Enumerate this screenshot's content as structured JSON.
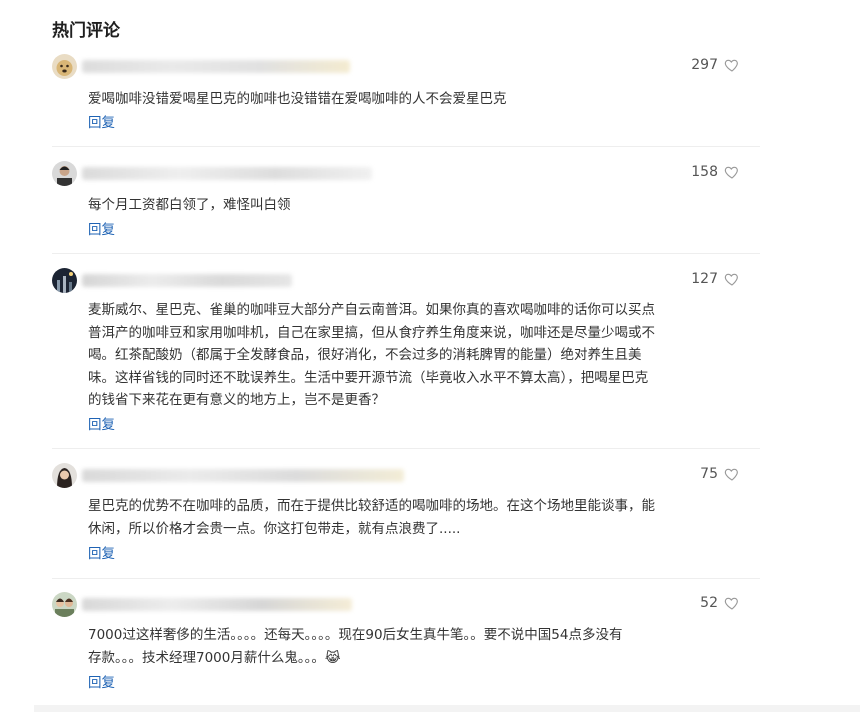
{
  "section_title": "热门评论",
  "reply_label": "回复",
  "comments": [
    {
      "likes": "297",
      "text": "爱喝咖啡没错爱喝星巴克的咖啡也没错错在爱喝咖啡的人不会爱星巴克"
    },
    {
      "likes": "158",
      "text": "每个月工资都白领了，难怪叫白领"
    },
    {
      "likes": "127",
      "text": "麦斯威尔、星巴克、雀巢的咖啡豆大部分产自云南普洱。如果你真的喜欢喝咖啡的话你可以买点\n普洱产的咖啡豆和家用咖啡机，自己在家里搞，但从食疗养生角度来说，咖啡还是尽量少喝或不\n喝。红茶配酸奶（都属于全发酵食品，很好消化，不会过多的消耗脾胃的能量）绝对养生且美\n味。这样省钱的同时还不耽误养生。生活中要开源节流（毕竟收入水平不算太高），把喝星巴克\n的钱省下来花在更有意义的地方上，岂不是更香？"
    },
    {
      "likes": "75",
      "text": "星巴克的优势不在咖啡的品质，而在于提供比较舒适的喝咖啡的场地。在这个场地里能谈事，能\n休闲，所以价格才会贵一点。你这打包带走，就有点浪费了....."
    },
    {
      "likes": "52",
      "text": "7000过这样奢侈的生活。。。。还每天。。。。现在90后女生真牛笔。。要不说中国54点多没有\n存款。。。技术经理7000月薪什么鬼。。。😹"
    }
  ]
}
